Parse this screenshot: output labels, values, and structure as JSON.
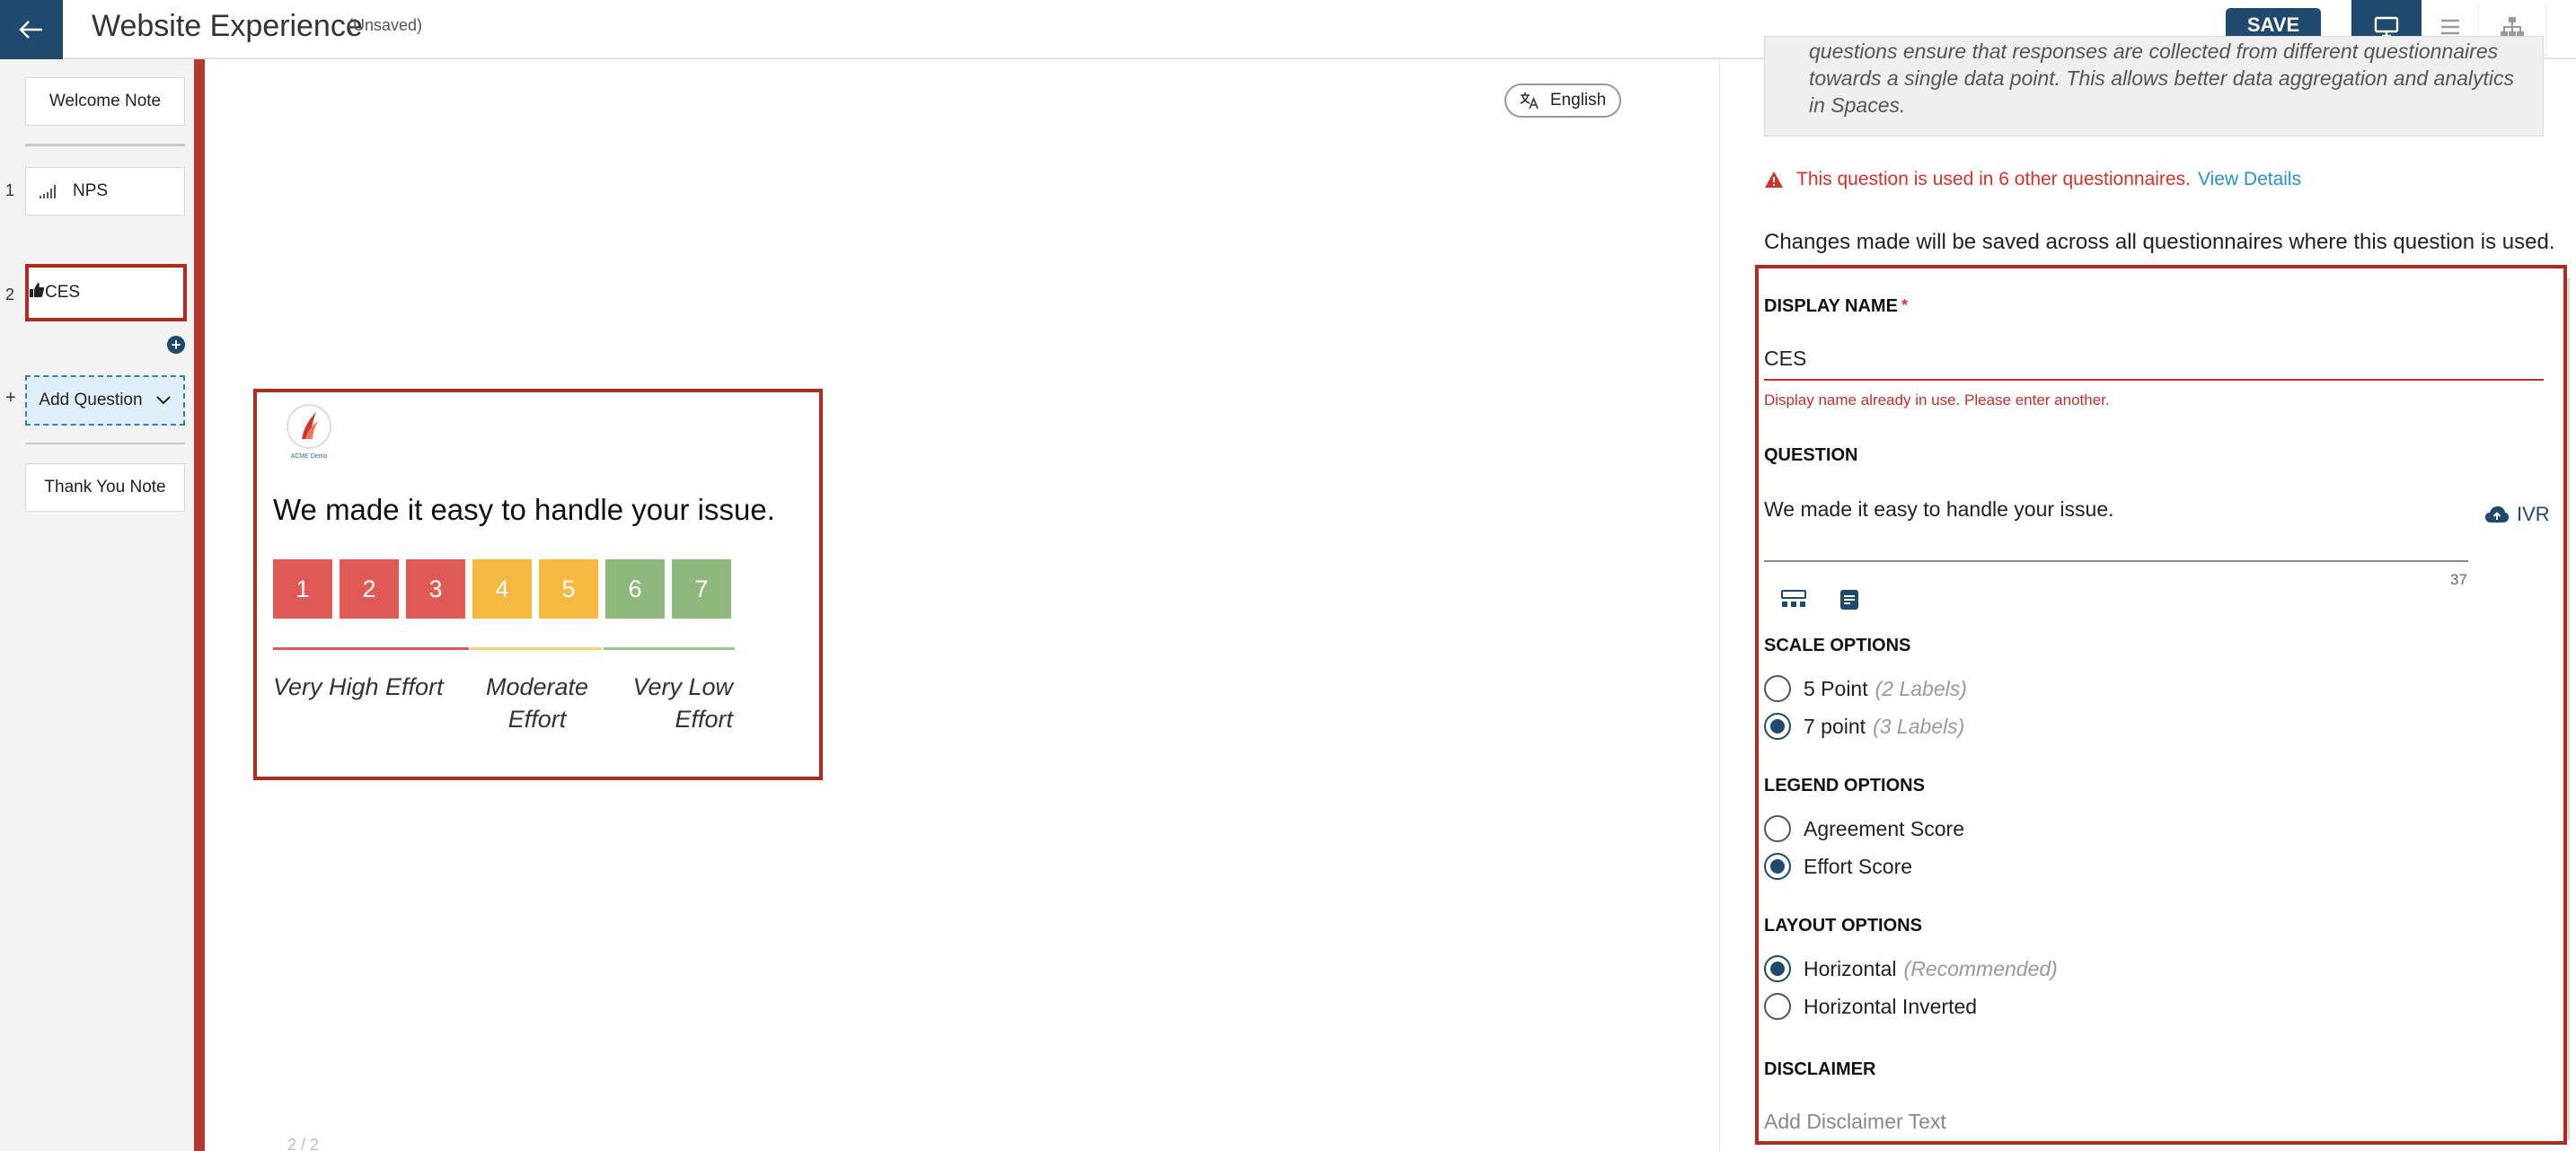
{
  "header": {
    "title": "Website Experience",
    "status": "(Unsaved)",
    "save_label": "SAVE",
    "accent_color": "#1f4a6e"
  },
  "sidebar": {
    "welcome": "Welcome Note",
    "items": [
      {
        "number": "1",
        "label": "NPS",
        "icon": "nps-chart-icon"
      },
      {
        "number": "2",
        "label": "CES",
        "icon": "thumbs-up-icon"
      }
    ],
    "add_plus": "+",
    "add_question": "Add Question",
    "thank_you": "Thank You Note"
  },
  "preview": {
    "language": "English",
    "logo_text": "ACME Demo",
    "question": "We made it easy to handle your issue.",
    "scale": [
      {
        "value": "1",
        "color": "#e05a55"
      },
      {
        "value": "2",
        "color": "#e05a55"
      },
      {
        "value": "3",
        "color": "#e05a55"
      },
      {
        "value": "4",
        "color": "#f5b942"
      },
      {
        "value": "5",
        "color": "#f5b942"
      },
      {
        "value": "6",
        "color": "#8fb87f"
      },
      {
        "value": "7",
        "color": "#8fb87f"
      }
    ],
    "legend": {
      "low": "Very High Effort",
      "mid": "Moderate Effort",
      "high": "Very Low Effort"
    },
    "pager": "2 / 2"
  },
  "panel": {
    "info_text": "questions ensure that responses are collected from different questionnaires towards a single data point. This allows better data aggregation and analytics in Spaces.",
    "warning_text": "This question is used in 6 other questionnaires.",
    "warning_link": "View Details",
    "changes_note": "Changes made will be saved across all questionnaires where this question is used.",
    "display_name_label": "DISPLAY NAME",
    "required_mark": "*",
    "display_name_value": "CES",
    "display_name_error": "Display name already in use. Please enter another.",
    "question_label": "QUESTION",
    "question_value": "We made it easy to handle your issue.",
    "char_count": "37",
    "ivr_label": "IVR",
    "scale_options_label": "SCALE OPTIONS",
    "scale_options": [
      {
        "label": "5 Point",
        "hint": "(2 Labels)",
        "selected": false
      },
      {
        "label": "7 point",
        "hint": "(3 Labels)",
        "selected": true
      }
    ],
    "legend_options_label": "LEGEND OPTIONS",
    "legend_options": [
      {
        "label": "Agreement Score",
        "selected": false
      },
      {
        "label": "Effort Score",
        "selected": true
      }
    ],
    "layout_options_label": "LAYOUT OPTIONS",
    "layout_options": [
      {
        "label": "Horizontal",
        "hint": "(Recommended)",
        "selected": true
      },
      {
        "label": "Horizontal Inverted",
        "hint": "",
        "selected": false
      }
    ],
    "disclaimer_label": "DISCLAIMER",
    "disclaimer_placeholder": "Add Disclaimer Text",
    "error_color": "#d0342c",
    "link_color": "#2a8fcf"
  }
}
